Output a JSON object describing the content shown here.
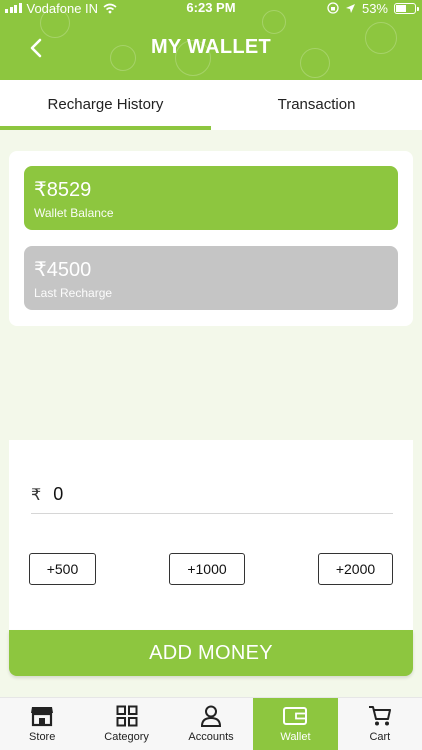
{
  "status_bar": {
    "carrier": "Vodafone IN",
    "time": "6:23 PM",
    "battery": "53%"
  },
  "header": {
    "title": "MY WALLET",
    "back_icon": "chevron-left-icon"
  },
  "tabs": [
    {
      "label": "Recharge History",
      "active": true
    },
    {
      "label": "Transaction",
      "active": false
    }
  ],
  "cards": {
    "wallet_balance": {
      "amount": "₹8529",
      "label": "Wallet Balance"
    },
    "last_recharge": {
      "amount": "₹4500",
      "label": "Last Recharge"
    }
  },
  "add_money": {
    "currency_symbol": "₹",
    "amount_value": "0",
    "quick_amounts": [
      "+500",
      "+1000",
      "+2000"
    ],
    "button_label": "ADD MONEY"
  },
  "bottom_nav": [
    {
      "label": "Store",
      "icon": "store-icon",
      "active": false
    },
    {
      "label": "Category",
      "icon": "grid-icon",
      "active": false
    },
    {
      "label": "Accounts",
      "icon": "user-icon",
      "active": false
    },
    {
      "label": "Wallet",
      "icon": "wallet-icon",
      "active": true
    },
    {
      "label": "Cart",
      "icon": "cart-icon",
      "active": false
    }
  ],
  "colors": {
    "accent": "#8dc63f",
    "background": "#f3f8ea",
    "inactive_card": "#c5c5c5"
  }
}
